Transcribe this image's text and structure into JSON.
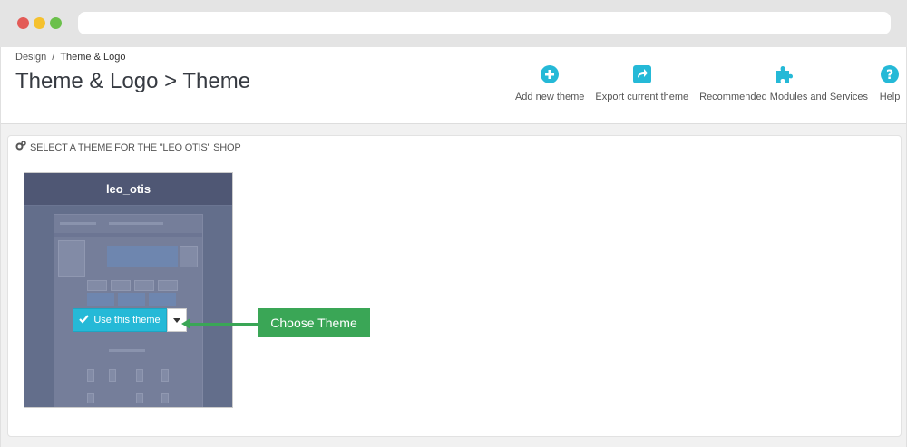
{
  "breadcrumb": {
    "parent": "Design",
    "separator": "/",
    "current": "Theme & Logo"
  },
  "page_title": "Theme & Logo > Theme",
  "actions": [
    {
      "label": "Add new theme",
      "icon": "plus-circle-icon"
    },
    {
      "label": "Export current theme",
      "icon": "share-icon"
    },
    {
      "label": "Recommended Modules and Services",
      "icon": "puzzle-icon"
    },
    {
      "label": "Help",
      "icon": "question-icon"
    }
  ],
  "panel": {
    "heading": "Select a theme for the \"Leo Otis\" shop",
    "icon": "cogs-icon"
  },
  "theme": {
    "name": "leo_otis",
    "use_button": "Use this theme"
  },
  "callout": {
    "text": "Choose Theme"
  },
  "colors": {
    "accent": "#25b9d7",
    "callout": "#3aa656",
    "card": "#5f6a86"
  }
}
